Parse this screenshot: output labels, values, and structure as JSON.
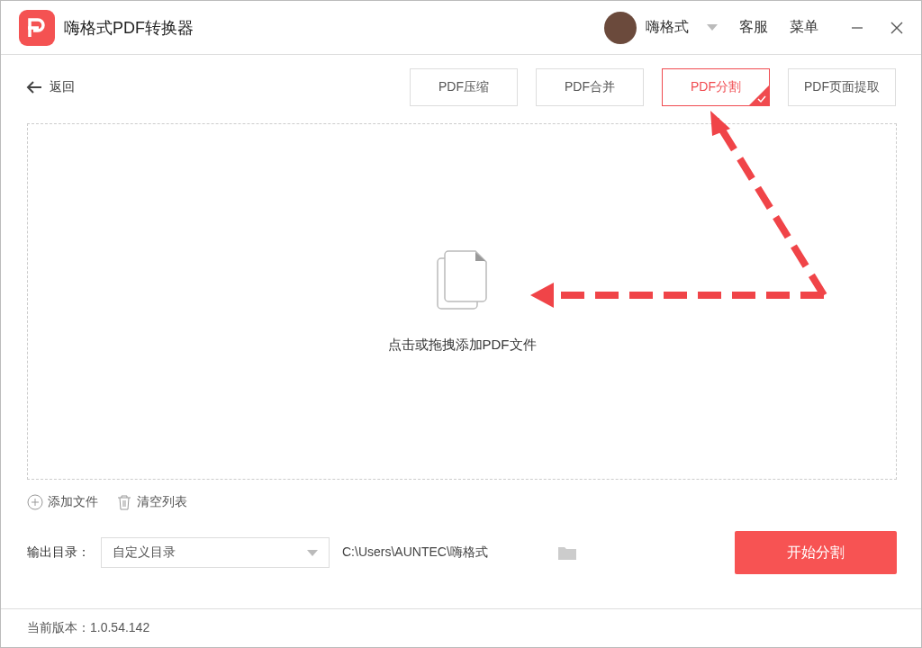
{
  "window": {
    "title": "嗨格式PDF转换器",
    "user": "嗨格式",
    "menu": [
      "客服",
      "菜单"
    ]
  },
  "back": "返回",
  "tabs": [
    {
      "label": "PDF压缩",
      "selected": false
    },
    {
      "label": "PDF合并",
      "selected": false
    },
    {
      "label": "PDF分割",
      "selected": true
    },
    {
      "label": "PDF页面提取",
      "selected": false
    }
  ],
  "drop_zone": {
    "hint": "点击或拖拽添加PDF文件"
  },
  "file_actions": [
    "添加文件",
    "清空列表"
  ],
  "output": {
    "label": "输出目录：",
    "select": "自定义目录",
    "path": "C:\\Users\\AUNTEC\\嗨格式"
  },
  "start_button": "开始分割",
  "status_bar": "当前版本：1.0.54.142"
}
